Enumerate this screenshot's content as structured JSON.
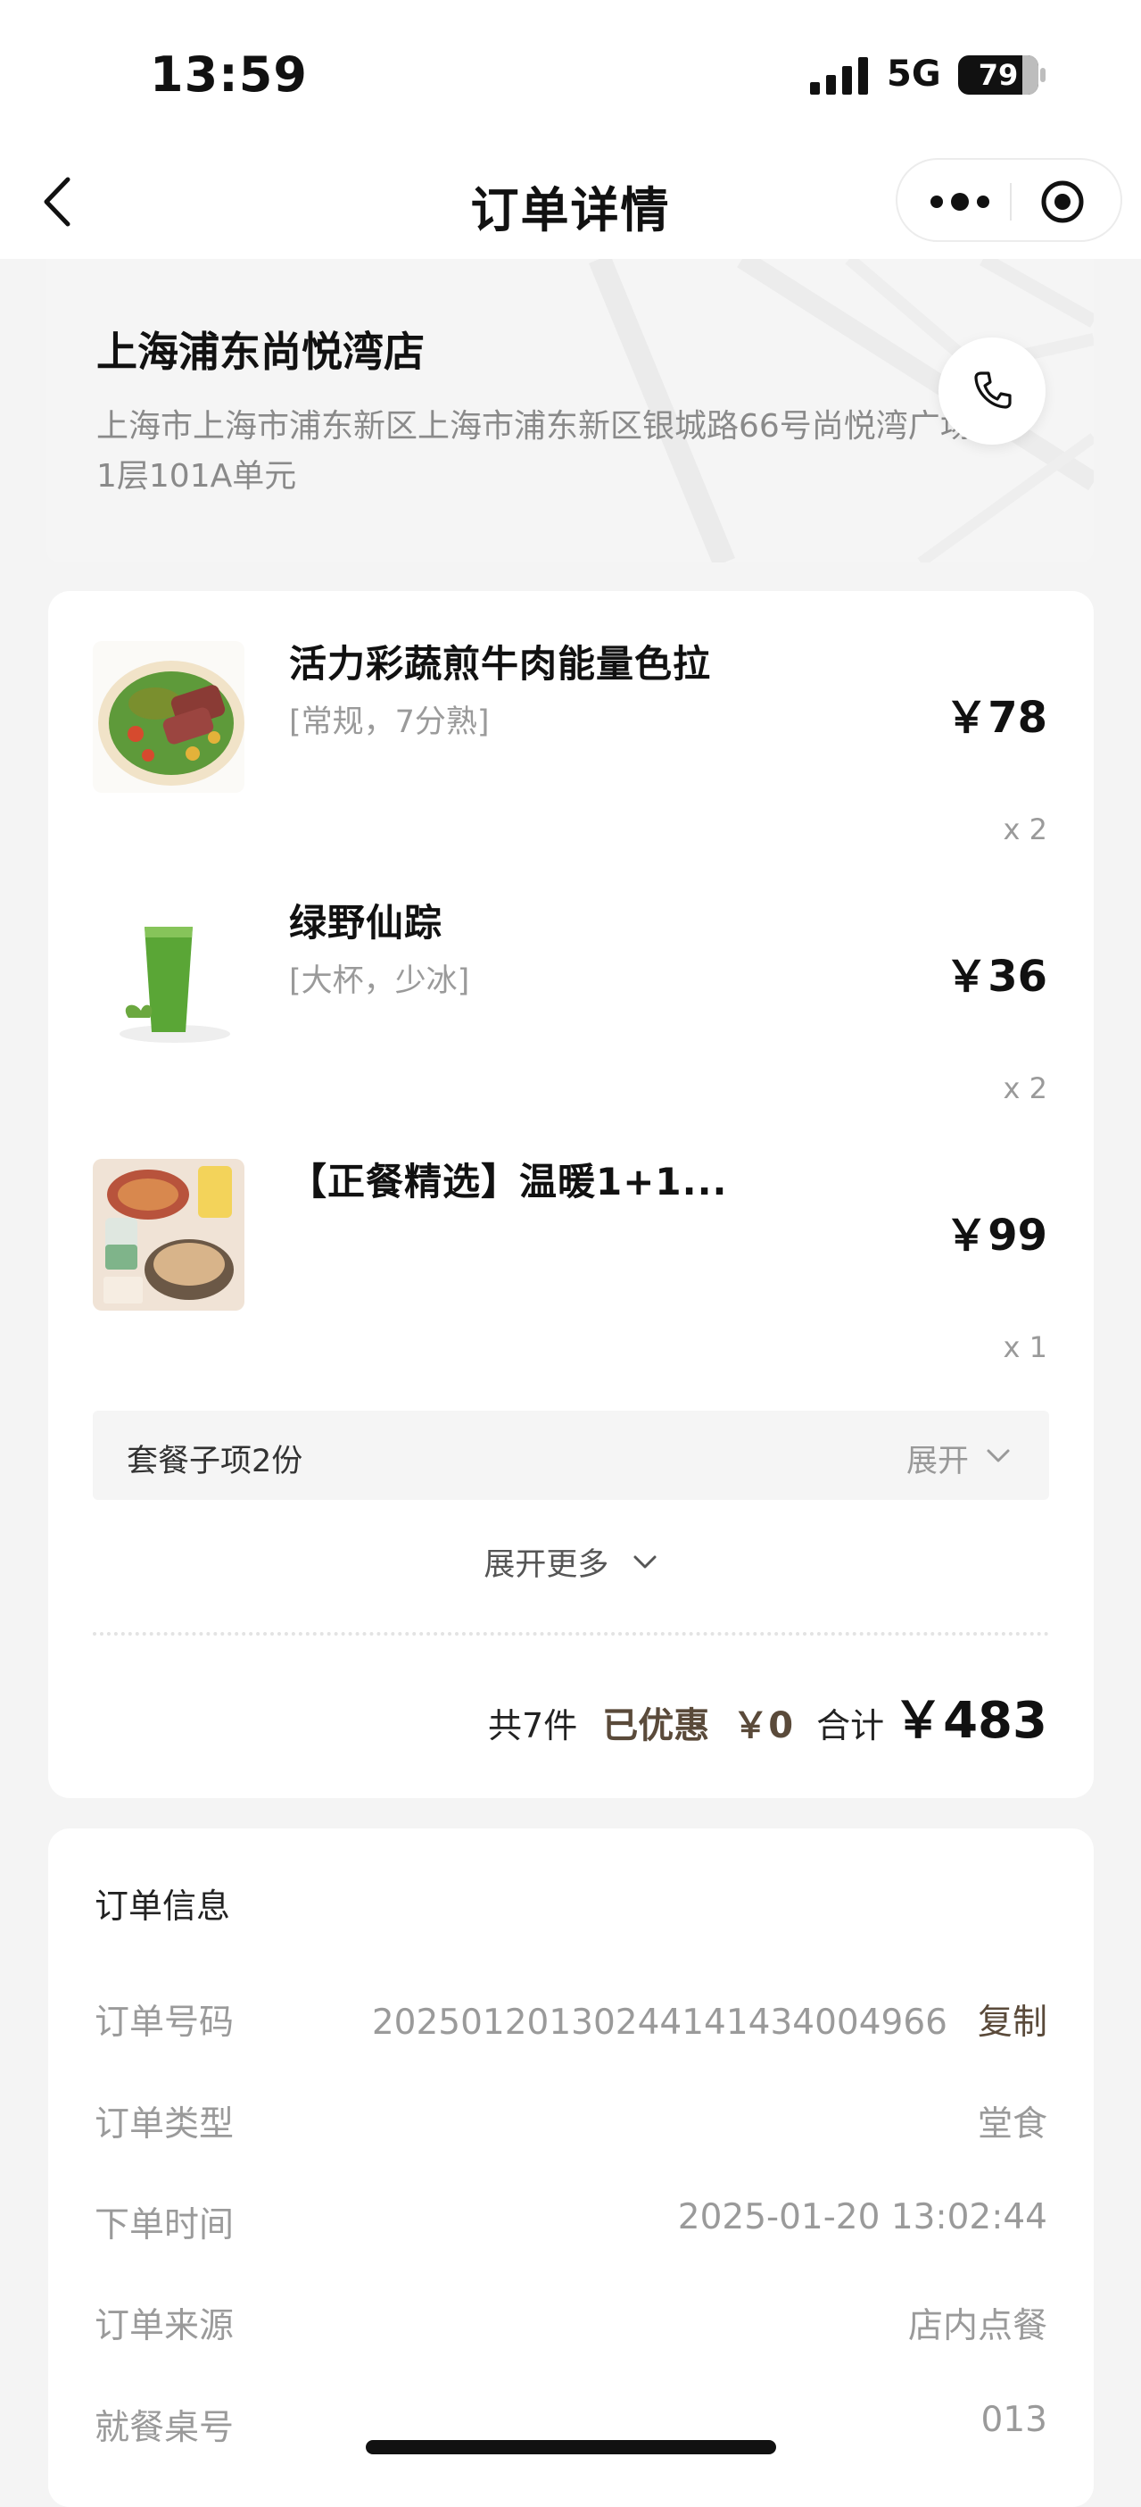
{
  "status_bar": {
    "time": "13:59",
    "network": "5G",
    "battery": "79"
  },
  "nav": {
    "title": "订单详情",
    "icons": [
      "back-icon",
      "more-dots-icon",
      "target-icon"
    ]
  },
  "store": {
    "name": "上海浦东尚悦湾店",
    "address": "上海市上海市浦东新区上海市浦东新区银城路66号尚悦湾广场1层101A单元",
    "call_icon": "phone-icon"
  },
  "order_items": [
    {
      "name": "活力彩蔬煎牛肉能量色拉",
      "spec": "[常规，7分熟]",
      "price": "￥78",
      "qty": "x 2"
    },
    {
      "name": "绿野仙踪",
      "spec": "[大杯，少冰]",
      "price": "￥36",
      "qty": "x 2"
    },
    {
      "name": "【正餐精选】温暖1+1...",
      "spec": "",
      "price": "￥99",
      "qty": "x 1"
    }
  ],
  "combo": {
    "label": "套餐子项2份",
    "expand": "展开"
  },
  "expand_more": "展开更多",
  "summary": {
    "count": "共7件",
    "discount_label": "已优惠",
    "discount_value": "￥0",
    "total_label": "合计",
    "total_value": "￥483"
  },
  "order_info": {
    "title": "订单信息",
    "rows": [
      {
        "label": "订单号码",
        "value": "20250120130244141434004966",
        "action": "复制"
      },
      {
        "label": "订单类型",
        "value": "堂食"
      },
      {
        "label": "下单时间",
        "value": "2025-01-20 13:02:44"
      },
      {
        "label": "订单来源",
        "value": "店内点餐"
      },
      {
        "label": "就餐桌号",
        "value": "013"
      }
    ]
  },
  "colors": {
    "accent_brown": "#5a4a3a",
    "muted_text": "#9a9a9a",
    "page_bg": "#f4f4f4"
  }
}
